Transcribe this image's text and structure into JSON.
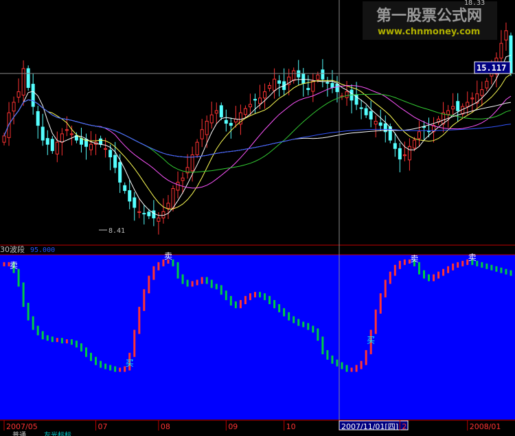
{
  "watermark": {
    "title": "第一股票公式网",
    "url": "www.chnmoney.com"
  },
  "price_panel": {
    "high_label": "18.33",
    "low_label": "8.41",
    "price_tag": "15.117"
  },
  "indicator_panel": {
    "name": "30波段",
    "value": "95.000",
    "buy_label": "买",
    "sell_label": "卖"
  },
  "time_axis": {
    "labels": [
      "2007/05",
      "07",
      "08",
      "09",
      "10",
      "2007/11/01[四]",
      "2",
      "2008/01"
    ],
    "cursor_label": "2007/11/01[四]"
  },
  "status": {
    "left": "普通",
    "right": "左光标标"
  },
  "chart_data": {
    "type": "candlestick",
    "title": "",
    "price_range": [
      8.0,
      19.0
    ],
    "indicator_range": [
      0,
      100
    ],
    "close": [
      12.8,
      13.9,
      14.4,
      14.9,
      16.0,
      15.1,
      14.2,
      13.3,
      12.6,
      12.4,
      12.1,
      12.5,
      12.9,
      13.1,
      12.9,
      12.6,
      12.4,
      12.3,
      12.4,
      12.5,
      12.4,
      12.2,
      11.8,
      11.3,
      10.6,
      10.2,
      9.7,
      9.4,
      9.2,
      9.1,
      9.0,
      8.9,
      8.9,
      9.2,
      9.6,
      10.3,
      10.6,
      10.8,
      11.3,
      11.9,
      12.5,
      13.1,
      13.5,
      13.8,
      14.0,
      13.7,
      13.4,
      13.3,
      13.6,
      13.9,
      14.1,
      14.3,
      14.5,
      14.6,
      14.9,
      15.2,
      15.5,
      15.3,
      15.0,
      15.6,
      15.9,
      15.6,
      15.3,
      15.0,
      15.4,
      15.7,
      15.5,
      15.3,
      15.1,
      14.9,
      14.7,
      14.9,
      14.5,
      14.3,
      14.1,
      13.8,
      13.6,
      13.5,
      13.3,
      13.0,
      12.6,
      12.2,
      11.7,
      11.9,
      12.3,
      12.6,
      13.0,
      13.2,
      13.0,
      13.3,
      13.6,
      13.9,
      14.0,
      14.2,
      14.0,
      14.2,
      14.4,
      14.6,
      14.8,
      15.0,
      15.4,
      15.9,
      16.5,
      17.2,
      17.8,
      15.8
    ],
    "indicator": [
      95,
      95,
      90,
      80,
      65,
      55,
      48,
      44,
      41,
      40,
      39,
      39,
      38,
      38,
      37,
      35,
      32,
      28,
      25,
      22,
      20,
      19,
      18,
      17,
      17,
      18,
      28,
      45,
      62,
      75,
      85,
      92,
      95,
      97,
      97,
      95,
      86,
      82,
      80,
      81,
      82,
      84,
      82,
      79,
      78,
      74,
      70,
      66,
      64,
      67,
      70,
      72,
      73,
      72,
      70,
      67,
      64,
      61,
      58,
      55,
      53,
      51,
      50,
      48,
      46,
      40,
      30,
      26,
      23,
      21,
      19,
      17,
      17,
      19,
      22,
      30,
      45,
      60,
      72,
      82,
      88,
      93,
      96,
      97,
      97,
      95,
      89,
      86,
      84,
      86,
      88,
      90,
      92,
      94,
      95,
      96,
      97,
      96,
      95,
      94,
      93,
      92,
      91,
      90,
      89,
      88
    ],
    "signals": [
      {
        "type": "sell",
        "index": 2
      },
      {
        "type": "buy",
        "index": 26
      },
      {
        "type": "sell",
        "index": 34
      },
      {
        "type": "buy",
        "index": 76
      },
      {
        "type": "sell",
        "index": 85
      },
      {
        "type": "sell",
        "index": 97
      }
    ],
    "moving_averages": [
      {
        "color": "#ffffff",
        "period": 5
      },
      {
        "color": "#ffff55",
        "period": 10
      },
      {
        "color": "#ff55ff",
        "period": 20
      },
      {
        "color": "#33cc33",
        "period": 30
      },
      {
        "color": "#ffffff",
        "period": 60
      },
      {
        "color": "#3355ff",
        "period": 120
      }
    ]
  }
}
